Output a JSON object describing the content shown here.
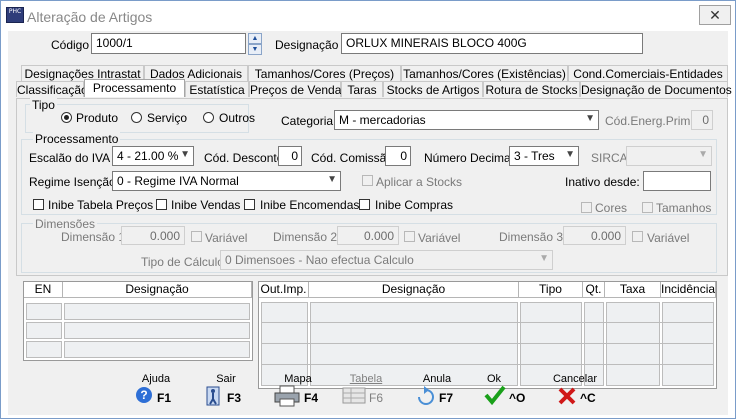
{
  "window": {
    "title": "Alteração de Artigos",
    "close_label": "✕",
    "app_icon_text": "PHC"
  },
  "header": {
    "codigo_label": "Código",
    "codigo_value": "1000/1",
    "designacao_label": "Designação",
    "designacao_value": "ORLUX MINERAIS BLOCO 400G"
  },
  "tabs_row1": [
    "Designações Intrastat",
    "Dados Adicionais",
    "Tamanhos/Cores (Preços)",
    "Tamanhos/Cores (Existências)",
    "Cond.Comerciais-Entidades"
  ],
  "tabs_row2": [
    "Classificação",
    "Processamento",
    "Estatística",
    "Preços de Venda",
    "Taras",
    "Stocks de Artigos",
    "Rotura de Stocks",
    "Designação de Documentos"
  ],
  "tipo": {
    "title": "Tipo",
    "options": [
      "Produto",
      "Serviço",
      "Outros"
    ],
    "selected": "Produto"
  },
  "categoria": {
    "label": "Categoria",
    "value": "M - mercadorias"
  },
  "cod_energ": {
    "label": "Cód.Energ.Prim",
    "value": "0"
  },
  "processamento": {
    "title": "Processamento",
    "escalao_label": "Escalão do IVA",
    "escalao_value": "4 - 21.00 %",
    "cod_desconto_label": "Cód. Desconto",
    "cod_desconto_value": "0",
    "cod_comissao_label": "Cód. Comissão",
    "cod_comissao_value": "0",
    "num_decimais_label": "Número Decimais",
    "num_decimais_value": "3 - Tres",
    "sirca_label": "SIRCA",
    "sirca_value": "",
    "regime_label": "Regime Isenção:",
    "regime_value": "0 - Regime IVA Normal",
    "aplicar_label": "Aplicar a Stocks",
    "inativo_label": "Inativo desde:",
    "inativo_value": "",
    "checks": [
      "Inibe Tabela Preços",
      "Inibe Vendas",
      "Inibe Encomendas",
      "Inibe Compras"
    ],
    "cores_label": "Cores",
    "tamanhos_label": "Tamanhos"
  },
  "dimensoes": {
    "title": "Dimensões",
    "dim1_label": "Dimensão 1",
    "dim1_value": "0.000",
    "dim2_label": "Dimensão 2",
    "dim2_value": "0.000",
    "dim3_label": "Dimensão 3",
    "dim3_value": "0.000",
    "variavel_label": "Variável",
    "tipo_calculo_label": "Tipo de Cálculo",
    "tipo_calculo_value": "0 Dimensoes - Nao efectua Calculo"
  },
  "grid_left": {
    "headers": [
      "EN",
      "Designação"
    ]
  },
  "grid_right": {
    "headers": [
      "Out.Imp.",
      "Designação",
      "Tipo",
      "Qt.",
      "Taxa",
      "Incidência"
    ]
  },
  "footer": {
    "ajuda": {
      "label": "Ajuda",
      "key": "F1"
    },
    "sair": {
      "label": "Sair",
      "key": "F3"
    },
    "mapa": {
      "label": "Mapa",
      "key": "F4"
    },
    "tabela": {
      "label": "Tabela",
      "key": "F6"
    },
    "anula": {
      "label": "Anula",
      "key": "F7"
    },
    "ok": {
      "label": "Ok",
      "key": "^O"
    },
    "cancelar": {
      "label": "Cancelar",
      "key": "^C"
    }
  },
  "colors": {
    "accent_blue": "#1f5fbf",
    "ok_green": "#1aa01a",
    "cancel_red": "#d01818",
    "frame": "#7a9cc9"
  }
}
